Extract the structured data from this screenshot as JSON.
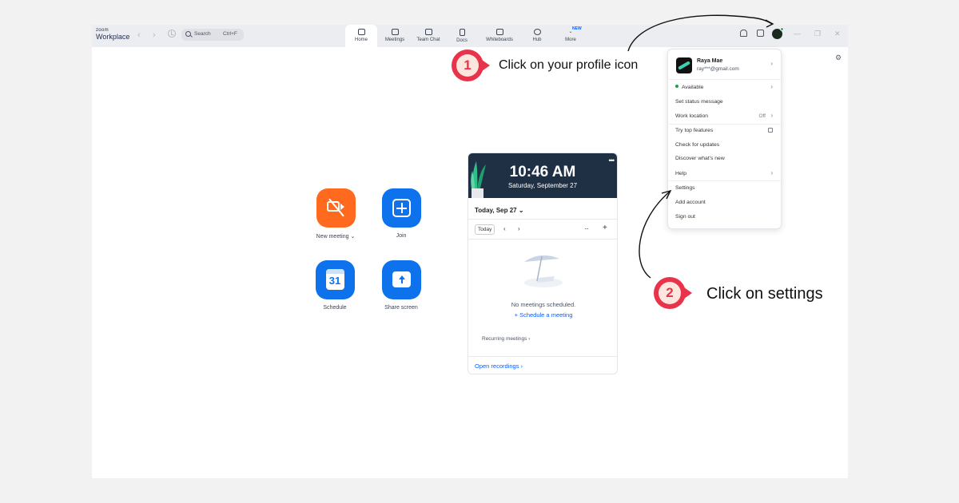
{
  "app": {
    "brand_small": "zoom",
    "brand_large": "Workplace"
  },
  "search": {
    "label": "Search",
    "shortcut": "Ctrl+F"
  },
  "tabs": [
    {
      "label": "Home",
      "icon": "home-icon",
      "active": true
    },
    {
      "label": "Meetings",
      "icon": "video-icon"
    },
    {
      "label": "Team Chat",
      "icon": "chat-icon"
    },
    {
      "label": "Docs",
      "icon": "doc-icon"
    },
    {
      "label": "Whiteboards",
      "icon": "whiteboard-icon"
    },
    {
      "label": "Hub",
      "icon": "hub-icon"
    },
    {
      "label": "More",
      "icon": "chevron-down-icon",
      "badge": "NEW"
    }
  ],
  "actions": {
    "new_meeting": "New meeting",
    "join": "Join",
    "schedule": "Schedule",
    "schedule_day": "31",
    "share_screen": "Share screen"
  },
  "calendar": {
    "time": "10:46 AM",
    "date": "Saturday, September 27",
    "day_selector": "Today, Sep 27",
    "today_button": "Today",
    "empty_text": "No meetings scheduled.",
    "schedule_link": "Schedule a meeting",
    "recurring": "Recurring meetings",
    "open_recordings": "Open recordings"
  },
  "profile_menu": {
    "name": "Raya Mae",
    "email": "ray***@gmail.com",
    "status": "Available",
    "set_status": "Set status message",
    "work_location": "Work location",
    "work_location_value": "Off",
    "try_features": "Try top features",
    "check_updates": "Check for updates",
    "whats_new": "Discover what's new",
    "help": "Help",
    "settings": "Settings",
    "add_account": "Add account",
    "sign_out": "Sign out"
  },
  "annotations": [
    {
      "number": "1",
      "text": "Click on your profile icon"
    },
    {
      "number": "2",
      "text": "Click on settings"
    }
  ],
  "colors": {
    "accent_red": "#e8334a",
    "zoom_blue": "#0e72ed",
    "orange": "#ff6a1f",
    "status_green": "#16a34a"
  }
}
